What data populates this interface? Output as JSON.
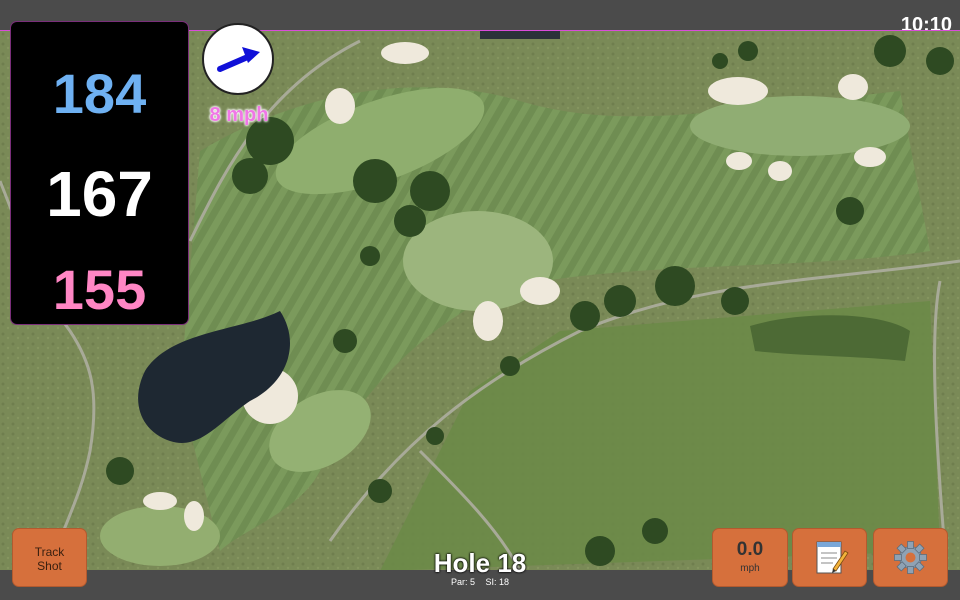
{
  "status_bar": {
    "time": "10:10"
  },
  "distances": {
    "back": "184",
    "middle": "167",
    "front": "155",
    "colors": {
      "back": "#6fb1f2",
      "middle": "#ffffff",
      "front": "#ff86c4"
    }
  },
  "wind": {
    "speed_label": "8 mph",
    "icon": "wind-arrow-icon"
  },
  "buttons": {
    "track_shot_line1": "Track",
    "track_shot_line2": "Shot",
    "speed_value": "0.0",
    "speed_unit": "mph",
    "notes_icon": "notepad-icon",
    "settings_icon": "gear-icon",
    "accent": "#d6703c"
  },
  "hole": {
    "title": "Hole 18",
    "par": "Par: 5",
    "stroke_index": "SI: 18"
  }
}
